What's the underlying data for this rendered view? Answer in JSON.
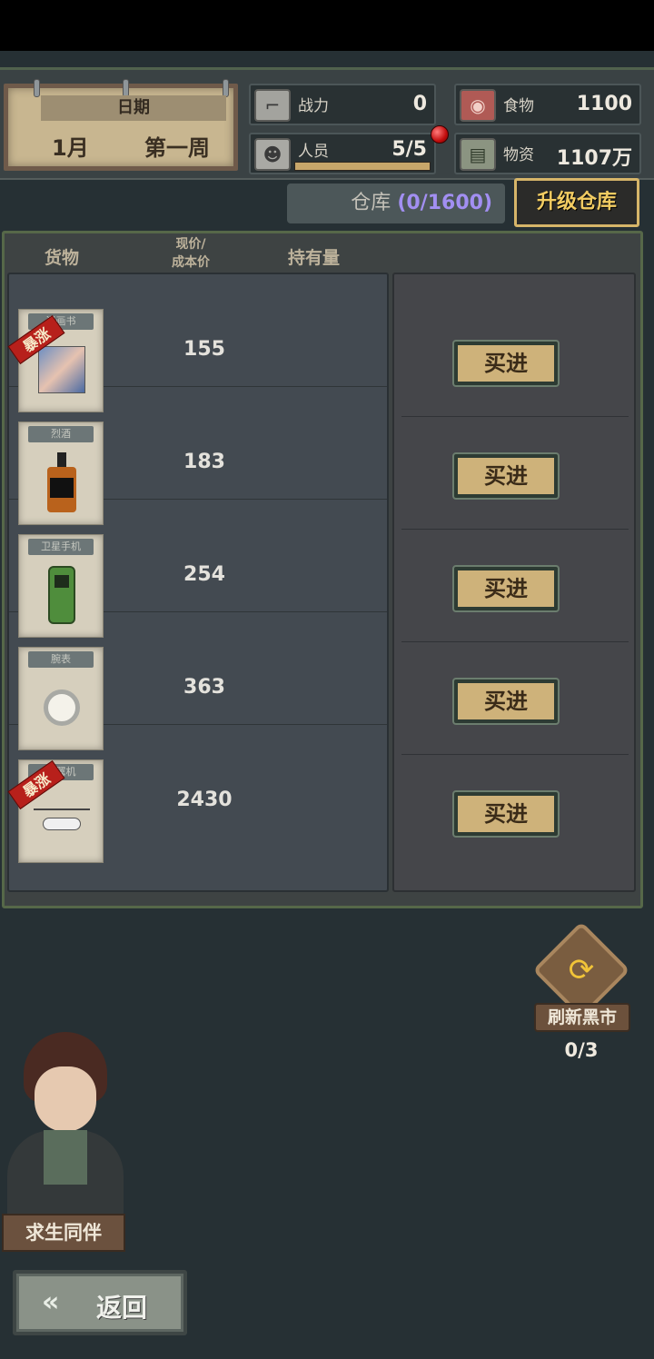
{
  "header": {
    "date_label": "日期",
    "month": "1月",
    "week": "第一周",
    "stats": {
      "power": {
        "label": "战力",
        "value": "0",
        "icon": "pistol-icon"
      },
      "people": {
        "label": "人员",
        "value": "5/5",
        "icon": "person-icon",
        "fill": 1.0
      },
      "food": {
        "label": "食物",
        "value": "1100",
        "icon": "meat-icon"
      },
      "supplies": {
        "label": "物资",
        "value": "1107万",
        "icon": "cash-icon"
      }
    }
  },
  "warehouse": {
    "label": "仓库",
    "count": "(0/1600)",
    "upgrade_label": "升级仓库"
  },
  "market": {
    "columns": {
      "goods": "货物",
      "price_line1": "现价/",
      "price_line2": "成本价",
      "holding": "持有量"
    },
    "items": [
      {
        "name": "漫画书",
        "price": "155",
        "badge": "暴涨",
        "buy": "买进"
      },
      {
        "name": "烈酒",
        "price": "183",
        "badge": "",
        "buy": "买进"
      },
      {
        "name": "卫星手机",
        "price": "254",
        "badge": "",
        "buy": "买进"
      },
      {
        "name": "腕表",
        "price": "363",
        "badge": "",
        "buy": "买进"
      },
      {
        "name": "旋翼机",
        "price": "2430",
        "badge": "暴涨",
        "buy": "买进"
      }
    ]
  },
  "refresh": {
    "label": "刷新黑市",
    "count": "0/3"
  },
  "companion": {
    "label": "求生同伴"
  },
  "back": {
    "label": "返回"
  }
}
